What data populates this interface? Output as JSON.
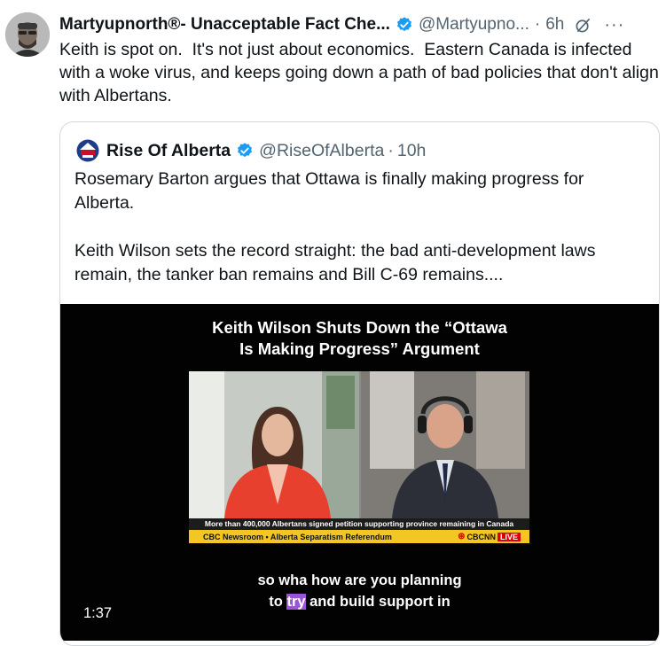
{
  "tweet": {
    "display_name": "Martyupnorth®- Unacceptable Fact Che...",
    "handle": "@Martyupno...",
    "separator": "·",
    "time": "6h",
    "more": "···",
    "text": "Keith is spot on.  It's not just about economics.  Eastern Canada is infected with a woke virus, and keeps going down a path of bad policies that don't align with Albertans."
  },
  "quote": {
    "display_name": "Rise Of Alberta",
    "handle": "@RiseOfAlberta",
    "separator": "·",
    "time": "10h",
    "text": "Rosemary Barton argues that Ottawa is finally making progress for Alberta.\n\nKeith Wilson sets the record straight: the bad anti-development laws remain, the tanker ban remains and Bill C-69 remains....",
    "avatar_text": "RISE OF ALBERTA"
  },
  "video": {
    "title_line1": "Keith Wilson Shuts Down the “Ottawa",
    "title_line2": "Is Making Progress” Argument",
    "ticker": "More than 400,000 Albertans signed petition supporting province remaining in Canada",
    "lower_third": "CBC Newsroom  •  Alberta Separatism Referendum",
    "network_logo": "⊛",
    "network": "CBCNN",
    "live": "LIVE",
    "caption_line1": "so wha how are you planning",
    "caption_line2_pre": "to ",
    "caption_line2_highlight": "try",
    "caption_line2_post": " and build support in",
    "duration": "1:37"
  },
  "colors": {
    "verified_blue": "#1d9bf0",
    "secondary_text": "#536471",
    "border": "#cfd9de",
    "lower_third_yellow": "#f3c623",
    "caption_highlight": "#9a55d6"
  },
  "icons": {
    "verified": "verified-badge-icon",
    "grok": "grok-icon",
    "more": "more-icon"
  }
}
